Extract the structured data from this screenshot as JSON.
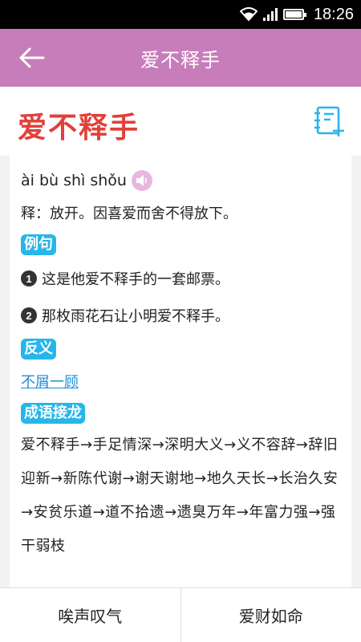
{
  "status": {
    "time": "18:26"
  },
  "appbar": {
    "title": "爱不释手"
  },
  "word": {
    "title": "爱不释手",
    "pinyin": "ài bù shì shǒu",
    "definition": "释：放开。因喜爱而舍不得放下。"
  },
  "sections": {
    "examples_label": "例句",
    "examples": [
      {
        "num": "1",
        "text": "这是他爱不释手的一套邮票。"
      },
      {
        "num": "2",
        "text": "那枚雨花石让小明爱不释手。"
      }
    ],
    "antonym_label": "反义",
    "antonym": "不屑一顾",
    "chain_label": "成语接龙",
    "chain": "爱不释手→手足情深→深明大义→义不容辞→辞旧迎新→新陈代谢→谢天谢地→地久天长→长治久安→安贫乐道→道不拾遗→遗臭万年→年富力强→强干弱枝"
  },
  "bottom": {
    "prev": "唉声叹气",
    "next": "爱财如命"
  },
  "colors": {
    "appbar": "#c87dbb",
    "title_red": "#e0413a",
    "tag_blue": "#26b6ea",
    "link_blue": "#1c8ed8"
  }
}
